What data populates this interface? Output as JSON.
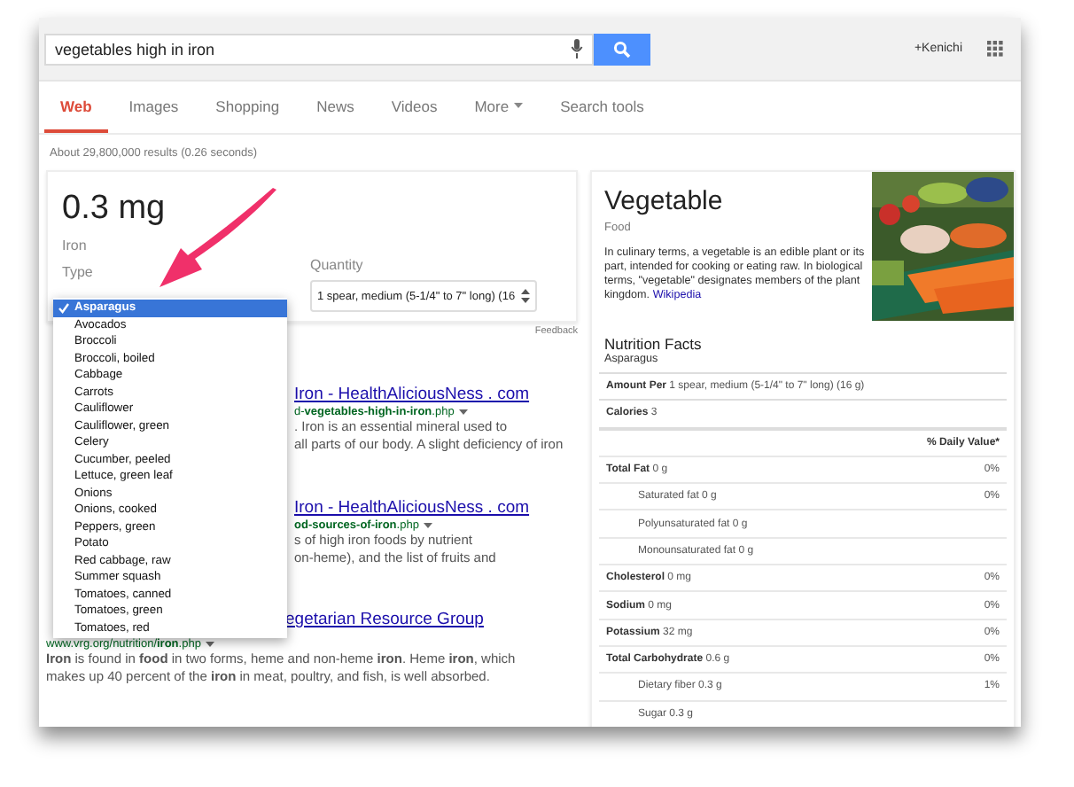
{
  "search": {
    "value": "vegetables high in iron"
  },
  "account": {
    "name": "+Kenichi"
  },
  "tabs": [
    {
      "label": "Web",
      "selected": true
    },
    {
      "label": "Images",
      "selected": false
    },
    {
      "label": "Shopping",
      "selected": false
    },
    {
      "label": "News",
      "selected": false
    },
    {
      "label": "Videos",
      "selected": false
    },
    {
      "label": "More",
      "selected": false,
      "kind": "menu"
    },
    {
      "label": "Search tools",
      "selected": false
    }
  ],
  "result_stats": "About 29,800,000 results (0.26 seconds)",
  "answer_card": {
    "amount": "0.3 mg",
    "nutrient": "Iron",
    "type_label": "Type",
    "quantity_label": "Quantity",
    "quantity_value": "1 spear, medium (5-1/4\" to 7\" long) (16",
    "feedback": "Feedback"
  },
  "type_options": [
    {
      "label": "Asparagus",
      "selected": true
    },
    {
      "label": "Avocados",
      "selected": false
    },
    {
      "label": "Broccoli",
      "selected": false
    },
    {
      "label": "Broccoli, boiled",
      "selected": false
    },
    {
      "label": "Cabbage",
      "selected": false
    },
    {
      "label": "Carrots",
      "selected": false
    },
    {
      "label": "Cauliflower",
      "selected": false
    },
    {
      "label": "Cauliflower, green",
      "selected": false
    },
    {
      "label": "Celery",
      "selected": false
    },
    {
      "label": "Cucumber, peeled",
      "selected": false
    },
    {
      "label": "Lettuce, green leaf",
      "selected": false
    },
    {
      "label": "Onions",
      "selected": false
    },
    {
      "label": "Onions, cooked",
      "selected": false
    },
    {
      "label": "Peppers, green",
      "selected": false
    },
    {
      "label": "Potato",
      "selected": false
    },
    {
      "label": "Red cabbage, raw",
      "selected": false
    },
    {
      "label": "Summer squash",
      "selected": false
    },
    {
      "label": "Tomatoes, canned",
      "selected": false
    },
    {
      "label": "Tomatoes, green",
      "selected": false
    },
    {
      "label": "Tomatoes, red",
      "selected": false
    }
  ],
  "results": [
    {
      "title": "Iron - HealthAliciousNess . com",
      "url": "d-**vegetables-high-in-iron**.php",
      "snippet_lines": [
        ". Iron is an essential mineral used to",
        "all parts of our body. A slight deficiency of iron"
      ]
    },
    {
      "title": "Iron - HealthAliciousNess . com",
      "url": "**od-sources-of-iron**.php",
      "snippet_lines": [
        "s of high iron foods by nutrient",
        "on-heme), and the list of fruits and"
      ]
    },
    {
      "title": "egetarian Resource Group",
      "url": "www.vrg.org/nutrition/**iron**.php",
      "snippet_lines": [
        "**Iron** is found in **food** in two forms, heme and non-heme **iron**. Heme **iron**, which makes up 40 percent of the **iron** in meat, poultry, and fish, is well absorbed."
      ]
    }
  ],
  "knowledge_panel": {
    "title": "Vegetable",
    "subtitle": "Food",
    "description": "In culinary terms, a vegetable is an edible plant or its part, intended for cooking or eating raw. In biological terms, \"vegetable\" designates members of the plant kingdom.",
    "source_link": "Wikipedia",
    "nutrition_title": "Nutrition Facts",
    "nutrition_subtitle": "Asparagus",
    "amount_per": "**Amount Per** 1 spear, medium (5-1/4\" to 7\" long) (16 g)",
    "calories": "**Calories** 3",
    "daily_value_header": "% Daily Value*",
    "nutrients": [
      {
        "label": "**Total Fat** 0 g",
        "value": "0%",
        "kind": "main"
      },
      {
        "label": "Saturated fat 0 g",
        "value": "0%",
        "kind": "sub"
      },
      {
        "label": "Polyunsaturated fat 0 g",
        "kind": "sub"
      },
      {
        "label": "Monounsaturated fat 0 g",
        "kind": "sub"
      },
      {
        "label": "**Cholesterol** 0 mg",
        "value": "0%",
        "kind": "main"
      },
      {
        "label": "**Sodium** 0 mg",
        "value": "0%",
        "kind": "main"
      },
      {
        "label": "**Potassium** 32 mg",
        "value": "0%",
        "kind": "main"
      },
      {
        "label": "**Total Carbohydrate** 0.6 g",
        "value": "0%",
        "kind": "main"
      },
      {
        "label": "Dietary fiber 0.3 g",
        "value": "1%",
        "kind": "sub"
      },
      {
        "label": "Sugar 0.3 g",
        "kind": "sub"
      }
    ]
  }
}
